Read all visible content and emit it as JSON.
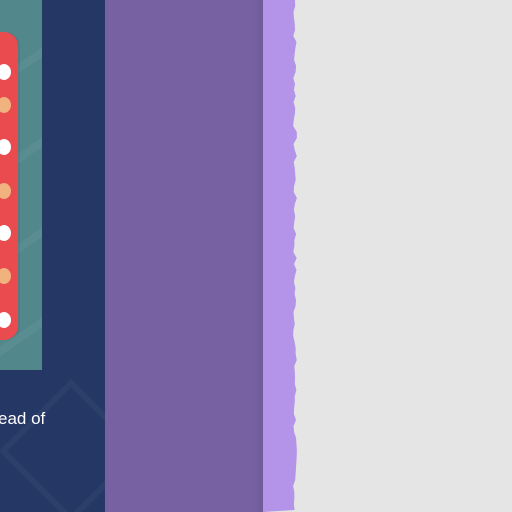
{
  "left_panel": {
    "caption": "ead of",
    "pills": [
      "white",
      "tan",
      "white",
      "tan",
      "white",
      "tan",
      "white"
    ]
  },
  "colors": {
    "navy_panel": "#253865",
    "teal_card": "#52878c",
    "red_strip": "#e94b4e",
    "pill_white": "#ffffff",
    "pill_tan": "#f0b27e",
    "purple_main": "#7761a3",
    "purple_light_edge": "#b394e8",
    "page_background": "#e5e5e5"
  }
}
